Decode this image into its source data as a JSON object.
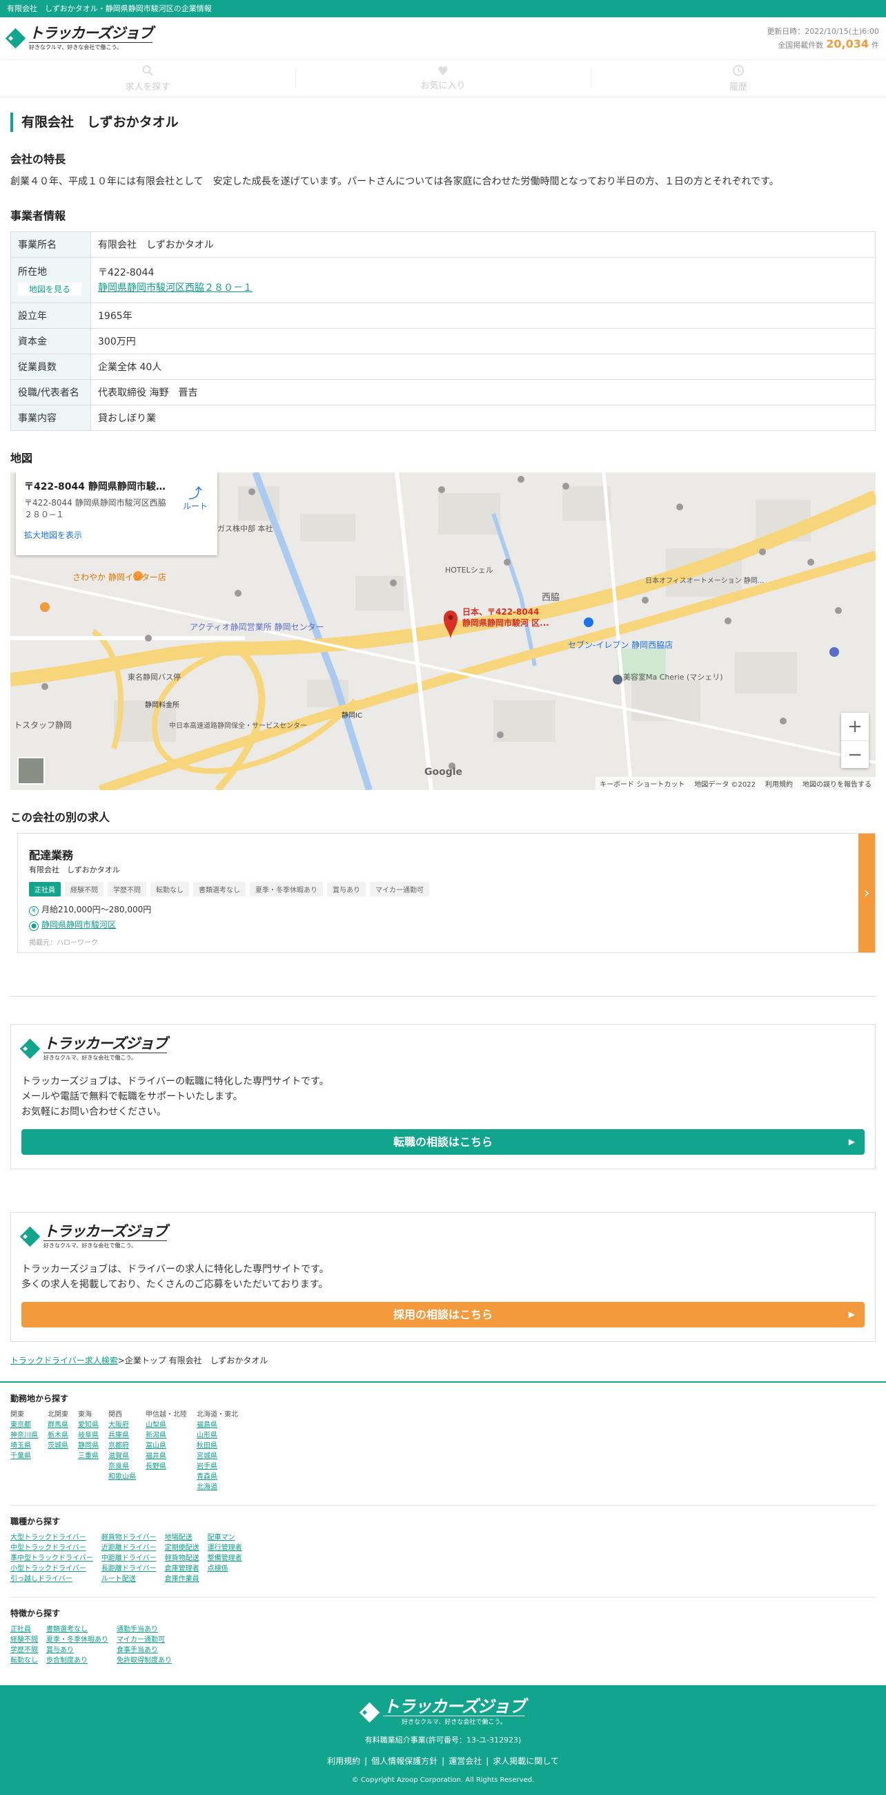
{
  "topbar": {
    "text": "有限会社　しずおかタオル・静岡県静岡市駿河区の企業情報"
  },
  "header": {
    "logo_name": "トラッカーズジョブ",
    "logo_tagline": "好きなクルマ、好きな会社で働こう。",
    "updated": "更新日時：2022/10/15(土)6:00",
    "count_label": "全国掲載件数",
    "count": "20,034",
    "count_unit": "件"
  },
  "nav": {
    "items": [
      {
        "label": "求人を探す",
        "icon": "search-icon"
      },
      {
        "label": "お気に入り",
        "icon": "heart-icon"
      },
      {
        "label": "履歴",
        "icon": "history-icon"
      }
    ]
  },
  "company": {
    "name": "有限会社　しずおかタオル",
    "feature_title": "会社の特長",
    "feature_text": "創業４０年、平成１０年には有限会社として　安定した成長を遂げています。パートさんについては各家庭に合わせた労働時間となっており半日の方、１日の方とそれぞれです。",
    "info_title": "事業者情報",
    "info": {
      "office_label": "事業所名",
      "office": "有限会社　しずおかタオル",
      "address_label": "所在地",
      "map_button": "地図を見る",
      "postal": "〒422-8044",
      "address": "静岡県静岡市駿河区西脇２８０－１",
      "founded_label": "設立年",
      "founded": "1965年",
      "capital_label": "資本金",
      "capital": "300万円",
      "employees_label": "従業員数",
      "employees": "企業全体 40人",
      "rep_label": "役職/代表者名",
      "rep": "代表取締役 海野　晋吉",
      "business_label": "事業内容",
      "business": "貸おしぼり業"
    }
  },
  "map": {
    "title": "地図",
    "card_title": "〒422-8044 静岡県静岡市駿河...",
    "card_addr": "〒422-8044 静岡県静岡市駿河区西脇２８０−１",
    "card_route": "ルート",
    "card_link": "拡大地図を表示",
    "pin_label_1": "日本、〒422-8044",
    "pin_label_2": "静岡県静岡市駿河 区...",
    "google": "Google",
    "footer": [
      "キーボード ショートカット",
      "地図データ ©2022",
      "利用規約",
      "地図の誤りを報告する"
    ],
    "places": [
      "さわやか 静岡インター店",
      "アクティオ静岡営業所 静岡センター",
      "東名静岡バス停",
      "静岡料金所",
      "セブン-イレブン 静岡西脇店",
      "美容室Ma Cherie (マシェリ)",
      "トスタッフ静岡",
      "HOTELシェル",
      "西脇",
      "日本オフィスオートメーション 静岡...",
      "静岡IC",
      "ガス株中部 本社",
      "中日本高速道路静岡保全・サービスセンター"
    ]
  },
  "other_jobs": {
    "title": "この会社の別の求人",
    "job": {
      "title": "配達業務",
      "company": "有限会社　しずおかタオル",
      "tags": [
        "正社員",
        "経験不問",
        "学歴不問",
        "転勤なし",
        "書類選考なし",
        "夏季・冬季休暇あり",
        "賞与あり",
        "マイカー通勤可"
      ],
      "salary": "月給210,000円～280,000円",
      "location": "静岡県静岡市駿河区",
      "source": "掲載元：ハローワーク"
    }
  },
  "promo1": {
    "text": [
      "トラッカーズジョブは、ドライバーの転職に特化した専門サイトです。",
      "メールや電話で無料で転職をサポートいたします。",
      "お気軽にお問い合わせください。"
    ],
    "button": "転職の相談はこちら"
  },
  "promo2": {
    "text": [
      "トラッカーズジョブは、ドライバーの求人に特化した専門サイトです。",
      "多くの求人を掲載しており、たくさんのご応募をいただいております。"
    ],
    "button": "採用の相談はこちら"
  },
  "breadcrumb": {
    "link": "トラックドライバー求人検索",
    "current": ">企業トップ 有限会社　しずおかタオル"
  },
  "search": {
    "region_title": "勤務地から探す",
    "regions": [
      {
        "head": "関東",
        "items": [
          "東京都",
          "神奈川県",
          "埼玉県",
          "千葉県"
        ]
      },
      {
        "head": "北関東",
        "items": [
          "群馬県",
          "栃木県",
          "茨城県"
        ]
      },
      {
        "head": "東海",
        "items": [
          "愛知県",
          "岐阜県",
          "静岡県",
          "三重県"
        ]
      },
      {
        "head": "関西",
        "items": [
          "大阪府",
          "兵庫県",
          "京都府",
          "滋賀県",
          "奈良県",
          "和歌山県"
        ]
      },
      {
        "head": "甲信越・北陸",
        "items": [
          "山梨県",
          "新潟県",
          "富山県",
          "福井県",
          "長野県"
        ]
      },
      {
        "head": "北海道・東北",
        "items": [
          "福島県",
          "山形県",
          "秋田県",
          "宮城県",
          "岩手県",
          "青森県",
          "北海道"
        ]
      }
    ],
    "job_title": "職種から探す",
    "job_cols": [
      [
        "大型トラックドライバー",
        "中型トラックドライバー",
        "準中型トラックドライバー",
        "小型トラックドライバー",
        "引っ越しドライバー"
      ],
      [
        "軽貨物ドライバー",
        "近距離ドライバー",
        "中距離ドライバー",
        "長距離ドライバー",
        "ルート配送"
      ],
      [
        "地場配送",
        "定期便配送",
        "軽貨物配送",
        "倉庫管理者",
        "倉庫作業員"
      ],
      [
        "配車マン",
        "運行管理者",
        "整備管理者",
        "点検係"
      ]
    ],
    "feature_title": "特徴から探す",
    "feature_cols": [
      [
        "正社員",
        "経験不問",
        "学歴不問",
        "転勤なし"
      ],
      [
        "書類選考なし",
        "夏季・冬季休暇あり",
        "賞与あり",
        "歩合制度あり"
      ],
      [
        "通勤手当あり",
        "マイカー通勤可",
        "食事手当あり",
        "免許取得制度あり"
      ]
    ]
  },
  "footer": {
    "license": "有料職業紹介事業(許可番号：13-ユ-312923)",
    "links": [
      "利用規約",
      "個人情報保護方針",
      "運営会社",
      "求人掲載に関して"
    ],
    "copyright": "© Copyright Azoop Corporation. All Rights Reserved."
  },
  "colors": {
    "brand": "#11a58e",
    "accent": "#f39a3c"
  }
}
